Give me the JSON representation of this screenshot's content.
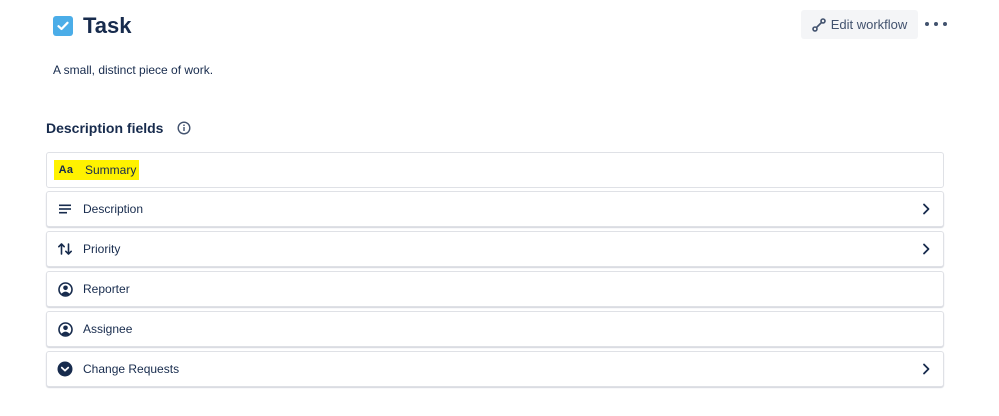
{
  "header": {
    "title": "Task",
    "icon": "checkbox-task-icon",
    "icon_color": "#4bade8"
  },
  "toolbar": {
    "edit_workflow_label": "Edit workflow",
    "edit_workflow_icon": "workflow-icon",
    "more_icon": "more-horizontal-icon"
  },
  "description": "A small, distinct piece of work.",
  "section": {
    "title": "Description fields",
    "info_icon": "info-icon"
  },
  "fields": [
    {
      "label": "Summary",
      "icon": "text-field-icon",
      "icon_text": "Aa",
      "highlighted": true,
      "highlight_color": "#fff200",
      "has_chevron": false
    },
    {
      "label": "Description",
      "icon": "paragraph-icon",
      "highlighted": false,
      "has_chevron": true
    },
    {
      "label": "Priority",
      "icon": "sort-arrows-icon",
      "highlighted": false,
      "has_chevron": true
    },
    {
      "label": "Reporter",
      "icon": "person-circle-icon",
      "highlighted": false,
      "has_chevron": false
    },
    {
      "label": "Assignee",
      "icon": "person-circle-icon",
      "highlighted": false,
      "has_chevron": false
    },
    {
      "label": "Change Requests",
      "icon": "chevron-circle-icon",
      "highlighted": false,
      "has_chevron": true
    }
  ]
}
